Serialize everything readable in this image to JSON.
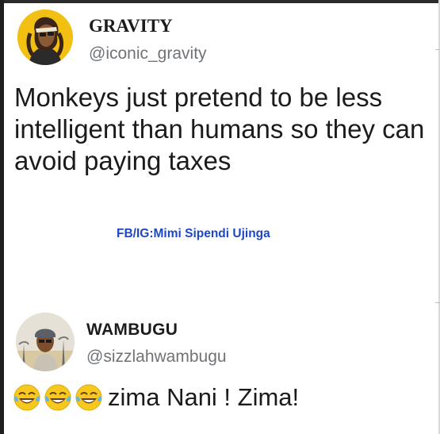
{
  "tweets": [
    {
      "name": "GRAVITY",
      "handle": "@iconic_gravity",
      "text": "Monkeys just pretend to be less intelligent than humans so they can avoid paying taxes",
      "watermark": "FB/IG:Mimi Sipendi Ujinga"
    },
    {
      "name": "WAMBUGU",
      "handle": "@sizzlahwambugu",
      "emojis": [
        "face-with-tears-of-joy-icon",
        "face-with-tears-of-joy-icon",
        "face-with-tears-of-joy-icon"
      ],
      "text": "zima Nani ! Zima!"
    }
  ],
  "colors": {
    "watermark": "#1f47c4",
    "handle": "#6f7377",
    "avatar_1_bg": "#f2c012"
  }
}
